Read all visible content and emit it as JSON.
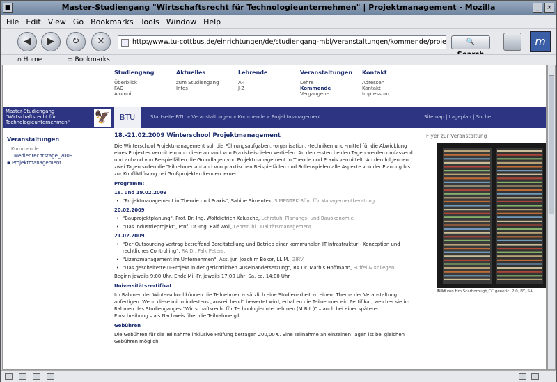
{
  "window": {
    "title": "Master-Studiengang \"Wirtschaftsrecht für Technologieunternehmen\" | Projektmanagement - Mozilla"
  },
  "menu": [
    "File",
    "Edit",
    "View",
    "Go",
    "Bookmarks",
    "Tools",
    "Window",
    "Help"
  ],
  "nav": {
    "url": "http://www.tu-cottbus.de/einrichtungen/de/studiengang-mbl/veranstaltungen/kommende/projektmanagement.html",
    "search_label": "Search"
  },
  "personal_bar": {
    "home": "Home",
    "bookmarks": "Bookmarks"
  },
  "topnav": [
    {
      "title": "Studiengang",
      "items": [
        "Überblick",
        "FAQ",
        "Alumni"
      ]
    },
    {
      "title": "Aktuelles",
      "items": [
        "zum Studiengang",
        "Infos"
      ]
    },
    {
      "title": "Lehrende",
      "items": [
        "A-I",
        "J-Z"
      ]
    },
    {
      "title": "Veranstaltungen",
      "items": [
        "Lehre",
        "Kommende",
        "Vergangene"
      ]
    },
    {
      "title": "Kontakt",
      "items": [
        "Adressen",
        "Kontakt",
        "Impressum"
      ]
    }
  ],
  "banner": {
    "left": "Master-Studiengang \"Wirtschaftsrecht für Technologieunternehmen\"",
    "btu": "BTU",
    "breadcrumb": "Startseite BTU » Veranstaltungen » Kommende » Projektmanagement",
    "links": "Sitemap | Lageplan | Suche"
  },
  "sidebar": {
    "heading": "Veranstaltungen",
    "sub": "Kommende",
    "items": [
      "Medienrechtstage_2009",
      "Projektmanagement"
    ]
  },
  "main": {
    "title": "18.-21.02.2009 Winterschool Projektmanagement",
    "intro": "Die Winterschool Projektmanagement soll die Führungsaufgaben, -organisation, -techniken und -mittel für die Abwicklung eines Projektes vermitteln und diese anhand von Praxisbeispielen vertiefen. An den ersten beiden Tagen werden umfassend und anhand von Beispielfällen die Grundlagen von Projektmanagement in Theorie und Praxis vermittelt. An den folgenden zwei Tagen sollen die Teilnehmer anhand von praktischen Beispielfällen und Rollenspielen alle Aspekte von der Planung bis zur Konfliktlösung bei Großprojekten kennen lernen.",
    "programm": "Programm:",
    "d1": "18. und 19.02.2009",
    "d1_items": [
      {
        "t": "\"Projektmanagement in Theorie und Praxis\", Sabine Simentek, ",
        "g": "SIMENTEK Büro für Managementberatung."
      }
    ],
    "d2": "20.02.2009",
    "d2_items": [
      {
        "t": "\"Bauprojektplanung\", Prof. Dr.-Ing. Wolfdietrich Kalusche, ",
        "g": "Lehrstuhl Planungs- und Bauökonomie."
      },
      {
        "t": "\"Das Industrieprojekt\", Prof. Dr.-Ing. Ralf Woll, ",
        "g": "Lehrstuhl Qualitätsmanagement."
      }
    ],
    "d3": "21.02.2009",
    "d3_items": [
      {
        "t": "\"Der Outsourcing-Vertrag betreffend Bereitstellung und Betrieb einer kommunalen IT-Infrastruktur - Konzeption und rechtliches Controlling\", ",
        "g": "RA Dr. Falk Peters."
      },
      {
        "t": "\"Lizenzmanagement im Unternehmen\", Ass. jur. Joachim Bokor, LL.M., ",
        "g": "ZIRV"
      },
      {
        "t": "\"Das gescheiterte IT-Projekt in der gerichtlichen Auseinandersetzung\", RA Dr. Mathis Hoffmann, ",
        "g": "Suffel & Kollegen"
      }
    ],
    "times": "Beginn jeweils 9:00 Uhr, Ende Mi.-Fr. jeweils 17:00 Uhr, Sa. ca. 14:00 Uhr.",
    "zert_h": "Universitätszertifikat",
    "zert": "Im Rahmen der Winterschool können die Teilnehmer zusätzlich eine Studienarbeit zu einem Thema der Veranstaltung anfertigen. Wenn diese mit mindestens „ausreichend\" bewertet wird, erhalten die Teilnehmer ein Zertifikat, welches sie im Rahmen des Studienganges \"Wirtschaftsrecht für Technologieunternehmen (M.B.L.)\" – auch bei einer späteren Einschreibung – als Nachweis über die Teilnahme gilt.",
    "geb_h": "Gebühren",
    "geb": "Die Gebühren für die Teilnahme inklusive Prüfung betragen 200,00 €. Eine Teilnahme an einzelnen Tagen ist bei gleichen Gebühren möglich."
  },
  "flyer": {
    "heading": "Flyer zur Veranstaltung",
    "caption_bold": "Bild",
    "caption": " von Hm Scarborough,CC generic. 2.0, BY, SA"
  }
}
